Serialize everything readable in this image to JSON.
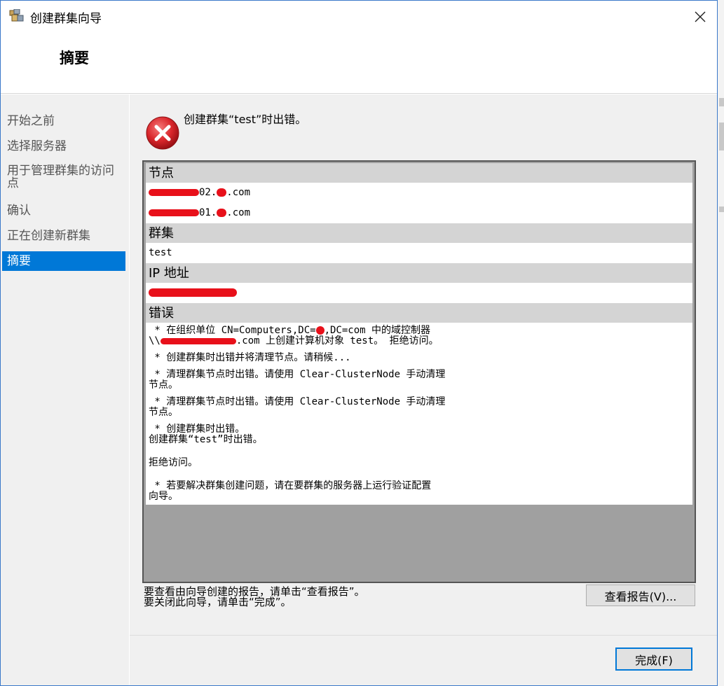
{
  "window": {
    "title": "创建群集向导",
    "close_label": "✕"
  },
  "header": {
    "page_title": "摘要"
  },
  "nav": {
    "items": [
      {
        "label": "开始之前"
      },
      {
        "label": "选择服务器"
      },
      {
        "label": "用于管理群集的访问\n点"
      },
      {
        "label": "确认"
      },
      {
        "label": "正在创建新群集"
      },
      {
        "label": "摘要"
      }
    ],
    "selected": "摘要"
  },
  "main": {
    "error_heading": "创建群集“test”时出错。",
    "report": {
      "nodes": {
        "heading": "节点",
        "values": [
          "02.",
          ".com",
          "01.",
          ".com"
        ]
      },
      "cluster": {
        "heading": "群集",
        "value": "test"
      },
      "ip": {
        "heading": "IP 地址"
      },
      "errors": {
        "heading": "错误",
        "lines": [
          " * 在组织单位 CN=Computers,DC=",
          ",DC=com 中的域控制器",
          "\\\\",
          ".com 上创建计算机对象 test。 拒绝访问。",
          " * 创建群集时出错并将清理节点。请稍候...",
          " * 清理群集节点时出错。请使用 Clear-ClusterNode 手动清理\n节点。",
          " * 清理群集节点时出错。请使用 Clear-ClusterNode 手动清理\n节点。",
          " * 创建群集时出错。\n创建群集“test”时出错。",
          "拒绝访问。",
          " * 若要解决群集创建问题，请在要群集的服务器上运行验证配置\n向导。"
        ]
      }
    },
    "footer_note_1": "要查看由向导创建的报告，请单击“查看报告”。",
    "footer_note_2": "要关闭此向导，请单击“完成”。",
    "view_report_button": "查看报告(V)...",
    "finish_button": "完成(F)"
  },
  "colors": {
    "accent": "#0078d7",
    "nav_bg": "#f0f0f0",
    "section_header": "#d4d4d4",
    "error_red": "#d9262b"
  }
}
